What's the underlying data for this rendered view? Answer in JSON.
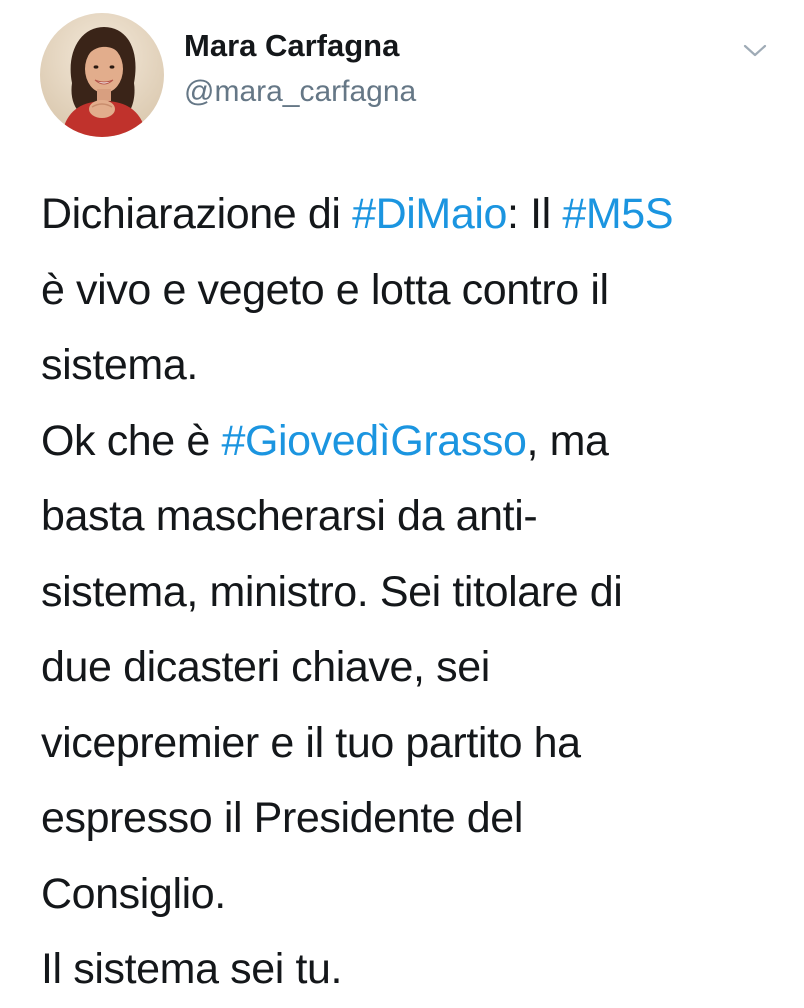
{
  "tweet": {
    "author": {
      "display_name": "Mara Carfagna",
      "handle": "@mara_carfagna"
    },
    "colors": {
      "text": "#14171a",
      "secondary": "#657786",
      "hashtag": "#1b95e0"
    },
    "icons": {
      "menu": "chevron-down-icon",
      "avatar": "profile-photo"
    },
    "lines": [
      [
        {
          "text": "Dichiarazione di "
        },
        {
          "text": "#DiMaio",
          "hashtag": true
        },
        {
          "text": ": Il "
        },
        {
          "text": "#M5S",
          "hashtag": true
        }
      ],
      [
        {
          "text": "è vivo e vegeto e lotta contro il"
        }
      ],
      [
        {
          "text": "sistema."
        }
      ],
      [
        {
          "text": "Ok che è "
        },
        {
          "text": "#GiovedìGrasso",
          "hashtag": true
        },
        {
          "text": ", ma"
        }
      ],
      [
        {
          "text": "basta mascherarsi da anti-"
        }
      ],
      [
        {
          "text": "sistema, ministro. Sei titolare di"
        }
      ],
      [
        {
          "text": "due dicasteri chiave, sei"
        }
      ],
      [
        {
          "text": "vicepremier e il tuo partito ha"
        }
      ],
      [
        {
          "text": "espresso il Presidente del"
        }
      ],
      [
        {
          "text": "Consiglio."
        }
      ],
      [
        {
          "text": "Il sistema sei tu."
        }
      ]
    ]
  }
}
